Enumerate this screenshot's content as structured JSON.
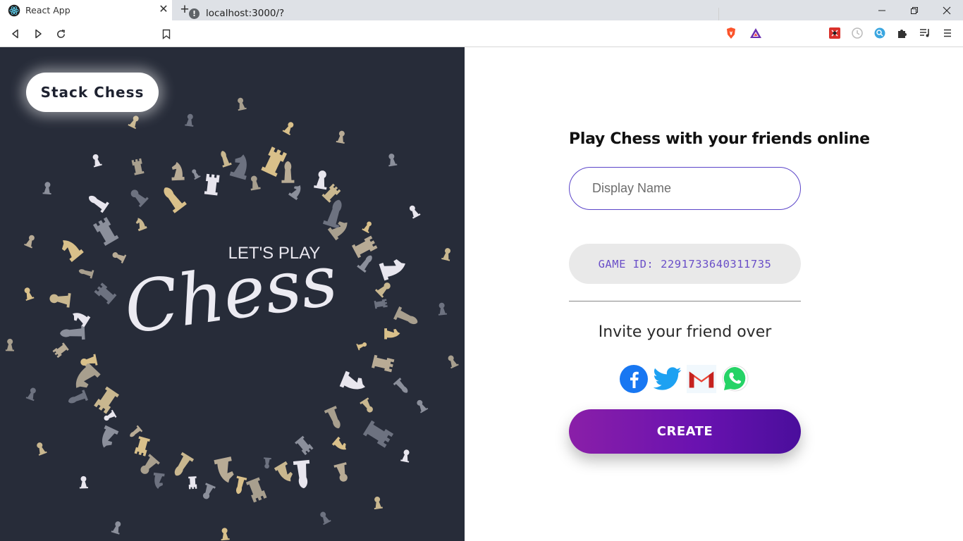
{
  "browser": {
    "tab_title": "React App",
    "url": "localhost:3000/?",
    "new_tab_icon": "plus-icon",
    "close_tab_icon": "close-icon"
  },
  "brand": {
    "name": "Stack Chess"
  },
  "hero_art": {
    "small_text": "LET'S PLAY",
    "script_text": "Chess"
  },
  "form": {
    "headline": "Play Chess with your friends online",
    "display_name_placeholder": "Display Name",
    "display_name_value": "",
    "game_id_label": "GAME ID: 2291733640311735",
    "invite_text": "Invite your friend over",
    "share_buttons": [
      "facebook-icon",
      "twitter-icon",
      "gmail-icon",
      "whatsapp-icon"
    ],
    "create_label": "CREATE"
  },
  "colors": {
    "left_panel_bg": "#272c39",
    "accent_purple": "#5b45c9",
    "game_id_text": "#6a4fc8",
    "create_gradient_start": "#8a1fa8",
    "create_gradient_end": "#4a0e9c"
  }
}
